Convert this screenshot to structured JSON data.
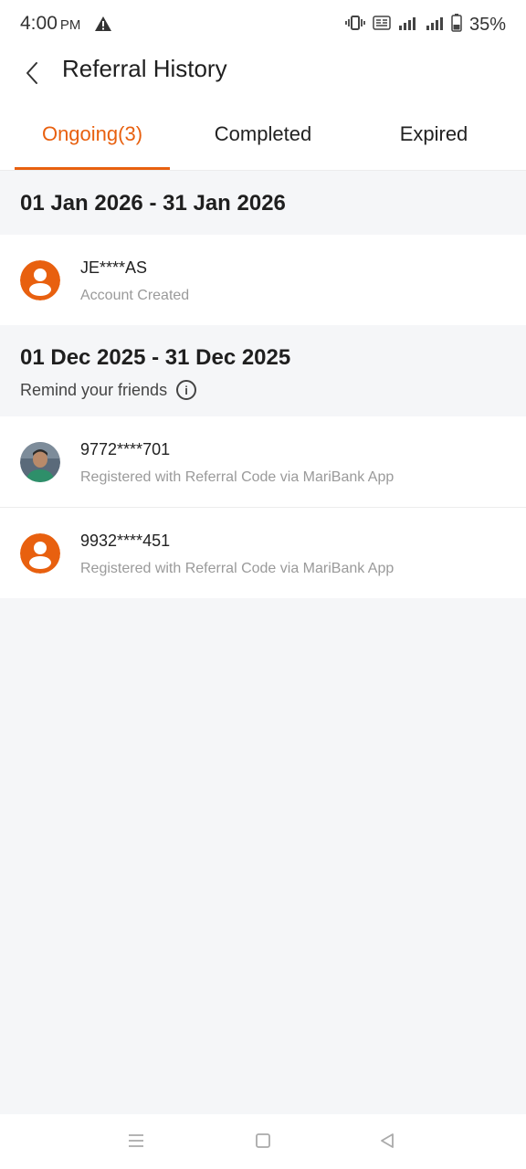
{
  "status_bar": {
    "time": "4:00",
    "ampm": "PM",
    "battery": "35%"
  },
  "header": {
    "title": "Referral History"
  },
  "tabs": [
    {
      "label": "Ongoing(3)",
      "active": true
    },
    {
      "label": "Completed",
      "active": false
    },
    {
      "label": "Expired",
      "active": false
    }
  ],
  "sections": [
    {
      "title": "01 Jan 2026 - 31 Jan 2026",
      "items": [
        {
          "name": "JE****AS",
          "status": "Account Created",
          "avatar": "default-avatar"
        }
      ]
    },
    {
      "title": "01 Dec 2025 - 31 Dec 2025",
      "remind": "Remind your friends",
      "items": [
        {
          "name": "9772****701",
          "status": "Registered with Referral Code via MariBank App",
          "avatar": "photo-avatar"
        },
        {
          "name": "9932****451",
          "status": "Registered with Referral Code via MariBank App",
          "avatar": "default-avatar"
        }
      ]
    }
  ],
  "colors": {
    "accent": "#e8600f",
    "background": "#f5f6f8"
  }
}
